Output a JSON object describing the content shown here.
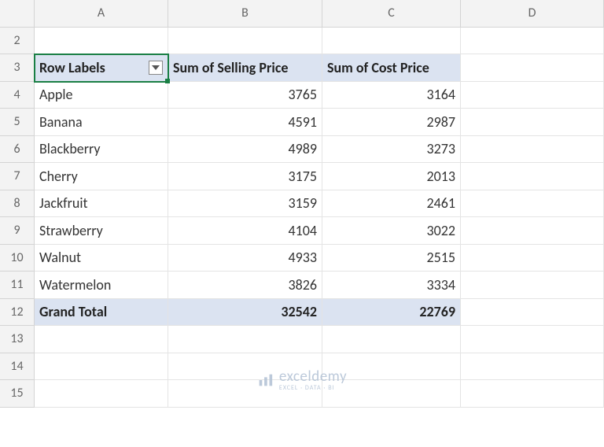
{
  "columns": [
    "A",
    "B",
    "C",
    "D"
  ],
  "rows": [
    2,
    3,
    4,
    5,
    6,
    7,
    8,
    9,
    10,
    11,
    12,
    13,
    14,
    15
  ],
  "activeCell": "A3",
  "pivot": {
    "headers": [
      "Row Labels",
      "Sum of Selling Price",
      "Sum of Cost Price"
    ],
    "items": [
      {
        "label": "Apple",
        "selling": 3765,
        "cost": 3164
      },
      {
        "label": "Banana",
        "selling": 4591,
        "cost": 2987
      },
      {
        "label": "Blackberry",
        "selling": 4989,
        "cost": 3273
      },
      {
        "label": "Cherry",
        "selling": 3175,
        "cost": 2013
      },
      {
        "label": "Jackfruit",
        "selling": 3159,
        "cost": 2461
      },
      {
        "label": "Strawberry",
        "selling": 4104,
        "cost": 3022
      },
      {
        "label": "Walnut",
        "selling": 4933,
        "cost": 2515
      },
      {
        "label": "Watermelon",
        "selling": 3826,
        "cost": 3334
      }
    ],
    "grandTotal": {
      "label": "Grand Total",
      "selling": 32542,
      "cost": 22769
    }
  },
  "watermark": {
    "brand": "exceldemy",
    "tag": "EXCEL · DATA · BI"
  }
}
